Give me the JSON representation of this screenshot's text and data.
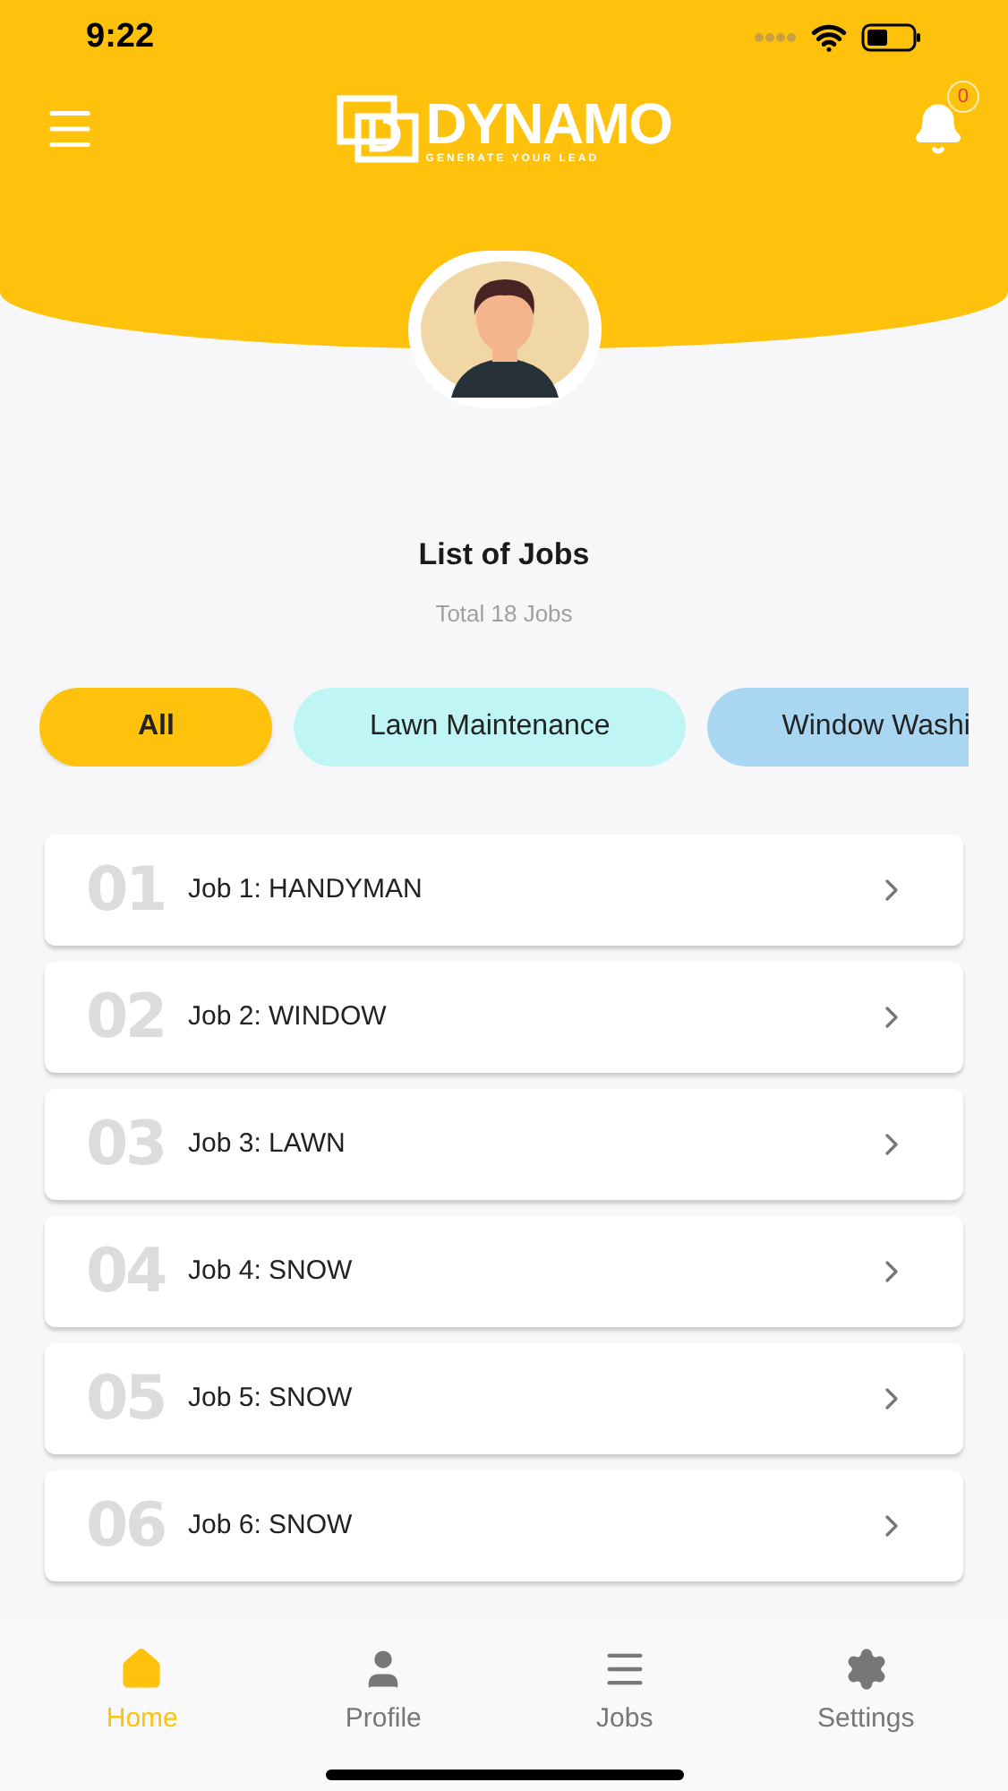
{
  "status_bar": {
    "time": "9:22"
  },
  "header": {
    "logo_name": "DYNAMO",
    "logo_tagline": "GENERATE YOUR LEAD",
    "notifications": "0"
  },
  "title": "List of Jobs",
  "subtitle": "Total 18 Jobs",
  "filters": [
    {
      "label": "All",
      "selected": true,
      "color": "#fec20c"
    },
    {
      "label": "Lawn Maintenance",
      "selected": false,
      "color": "#bff5f5"
    },
    {
      "label": "Window Washi",
      "selected": false,
      "color": "#a9d7f2"
    }
  ],
  "jobs": [
    {
      "number": "01",
      "title": "Job 1: HANDYMAN"
    },
    {
      "number": "02",
      "title": "Job 2: WINDOW"
    },
    {
      "number": "03",
      "title": "Job 3: LAWN"
    },
    {
      "number": "04",
      "title": "Job 4: SNOW"
    },
    {
      "number": "05",
      "title": "Job 5: SNOW"
    },
    {
      "number": "06",
      "title": "Job 6: SNOW"
    }
  ],
  "bottom_nav": [
    {
      "label": "Home",
      "kind": "home",
      "selected": true
    },
    {
      "label": "Profile",
      "kind": "profile",
      "selected": false
    },
    {
      "label": "Jobs",
      "kind": "jobs",
      "selected": false
    },
    {
      "label": "Settings",
      "kind": "settings",
      "selected": false
    }
  ]
}
